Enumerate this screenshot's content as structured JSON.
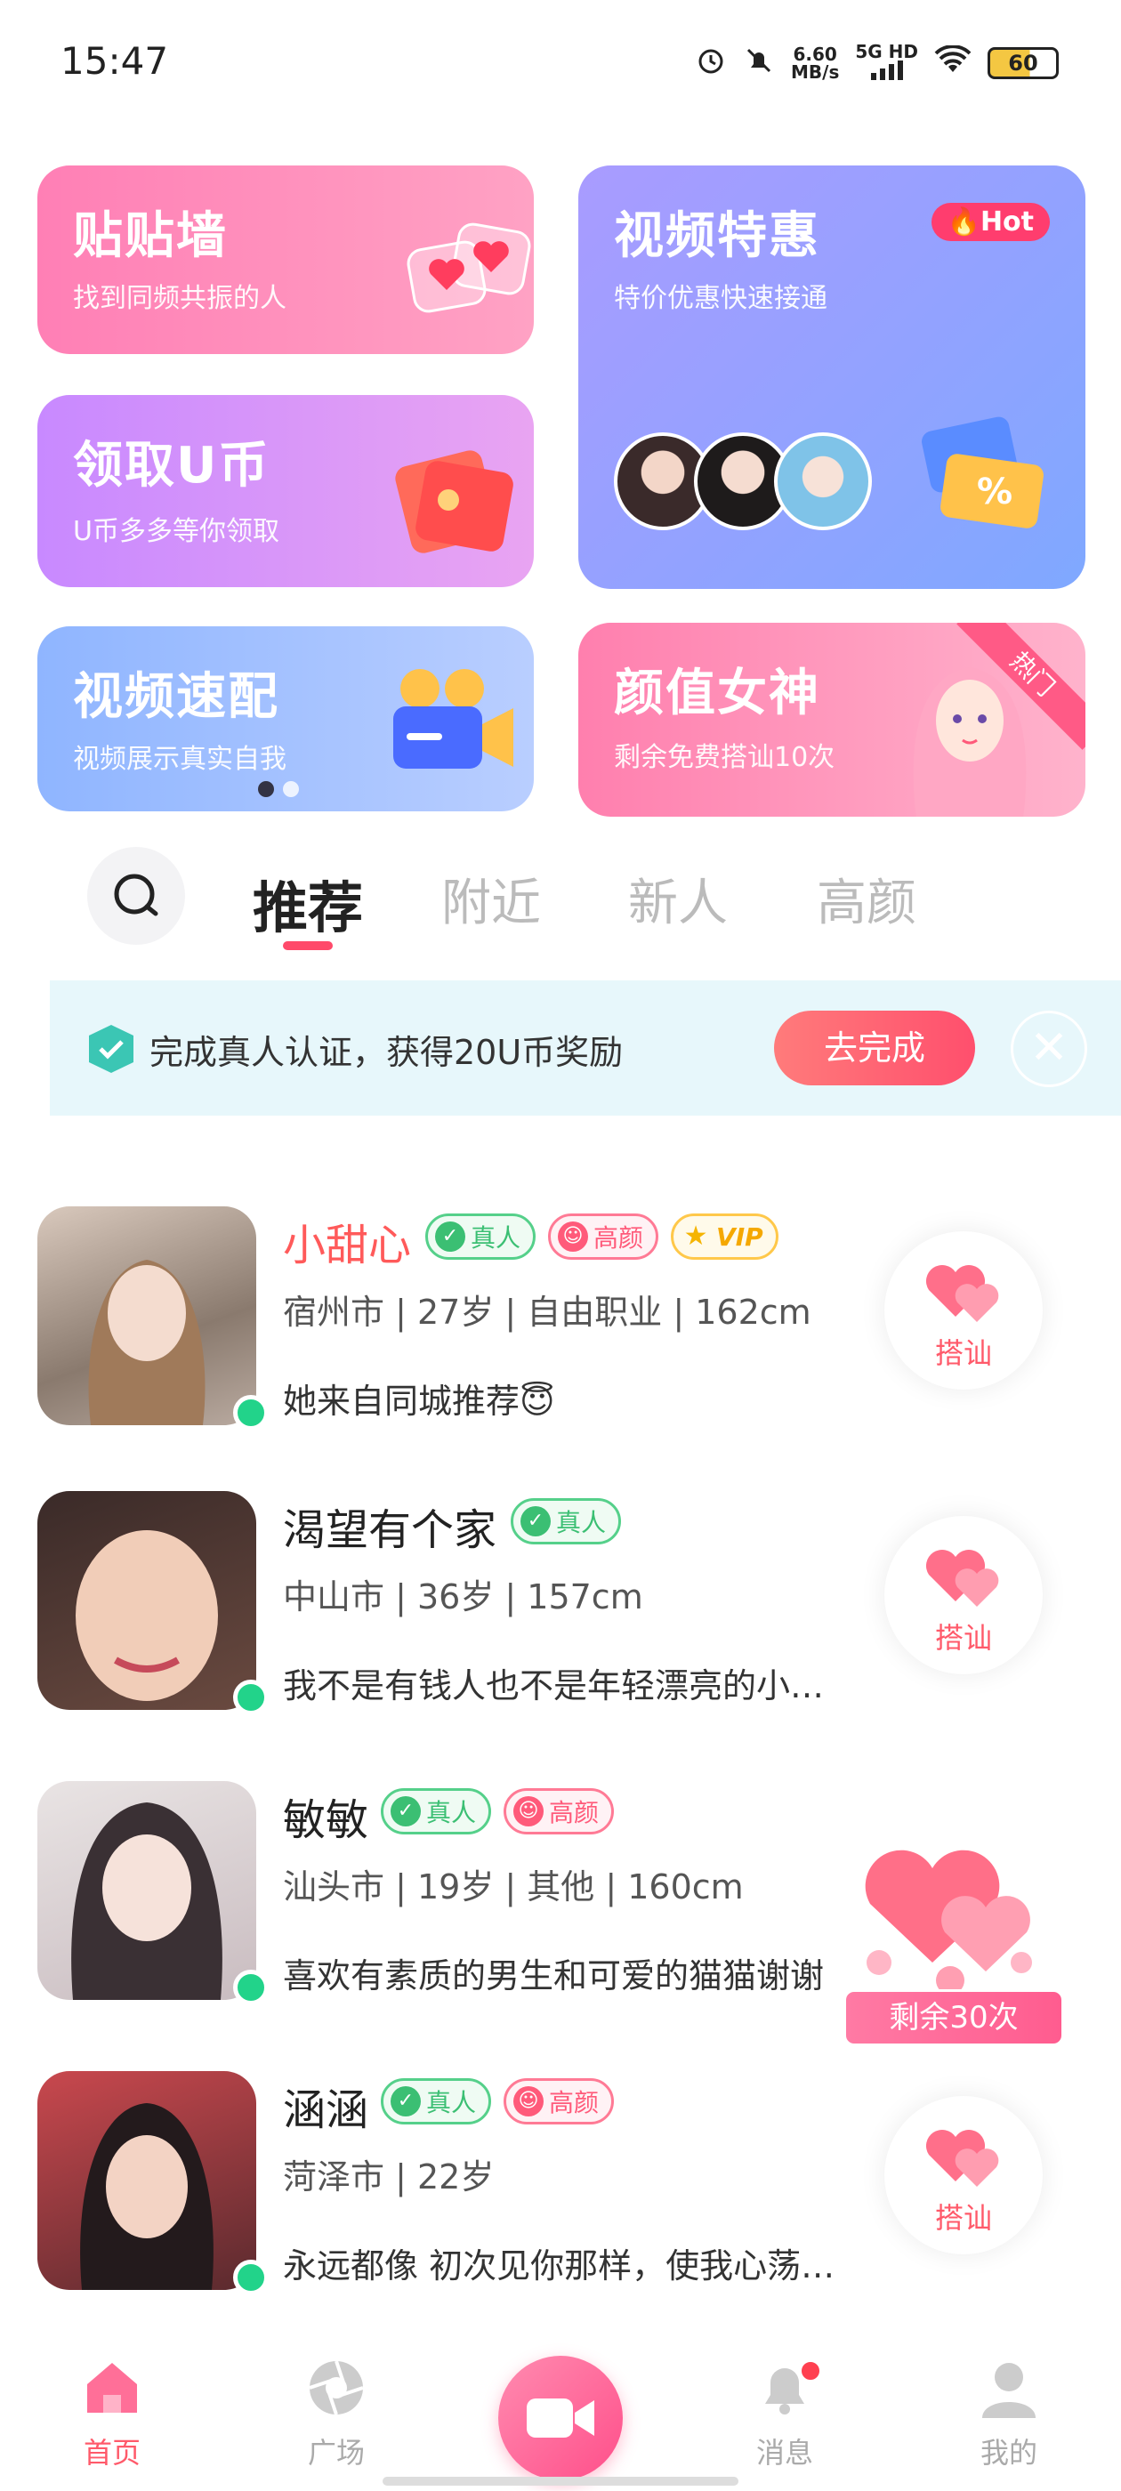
{
  "status_bar": {
    "time": "15:47",
    "net_speed_top": "6.60",
    "net_speed_bottom": "MB/s",
    "signal": "5G HD",
    "battery": "60"
  },
  "cards": {
    "tiepai": {
      "title": "贴贴墙",
      "subtitle": "找到同频共振的人"
    },
    "video_deal": {
      "title": "视频特惠",
      "subtitle": "特价优惠快速接通",
      "badge": "Hot"
    },
    "ucoin": {
      "title": "领取U币",
      "subtitle": "U币多多等你领取"
    },
    "video_match": {
      "title": "视频速配",
      "subtitle": "视频展示真实自我"
    },
    "goddess": {
      "title": "颜值女神",
      "subtitle": "剩余免费搭讪10次",
      "corner": "热门"
    }
  },
  "tabs": [
    {
      "label": "推荐",
      "active": true
    },
    {
      "label": "附近",
      "active": false
    },
    {
      "label": "新人",
      "active": false
    },
    {
      "label": "高颜",
      "active": false
    }
  ],
  "verify_banner": {
    "text": "完成真人认证，获得20U币奖励",
    "button": "去完成",
    "close": "✕"
  },
  "badges": {
    "real": "真人",
    "beauty": "高颜",
    "vip": "VIP"
  },
  "users": [
    {
      "name": "小甜心",
      "info": "宿州市 | 27岁 | 自由职业 | 162cm",
      "sign": "她来自同城推荐😇",
      "vip": true,
      "beauty": true,
      "action": "搭讪"
    },
    {
      "name": "渴望有个家",
      "info": "中山市 | 36岁 | 157cm",
      "sign": "我不是有钱人也不是年轻漂亮的小…",
      "vip": false,
      "beauty": false,
      "action": "搭讪"
    },
    {
      "name": "敏敏",
      "info": "汕头市 | 19岁 | 其他 | 160cm",
      "sign": "喜欢有素质的男生和可爱的猫猫谢谢",
      "vip": false,
      "beauty": true,
      "action": ""
    },
    {
      "name": "涵涵",
      "info": "菏泽市 | 22岁",
      "sign": "永远都像 初次见你那样，使我心荡…",
      "vip": false,
      "beauty": true,
      "action": "搭讪"
    }
  ],
  "promo": {
    "label": "剩余30次"
  },
  "nav": [
    {
      "label": "首页",
      "icon": "home-icon"
    },
    {
      "label": "广场",
      "icon": "aperture-icon"
    },
    {
      "label": "",
      "icon": "video-camera-icon"
    },
    {
      "label": "消息",
      "icon": "bell-icon"
    },
    {
      "label": "我的",
      "icon": "profile-icon"
    }
  ],
  "colors": {
    "accent": "#ff5a6a",
    "online": "#22d38a"
  }
}
